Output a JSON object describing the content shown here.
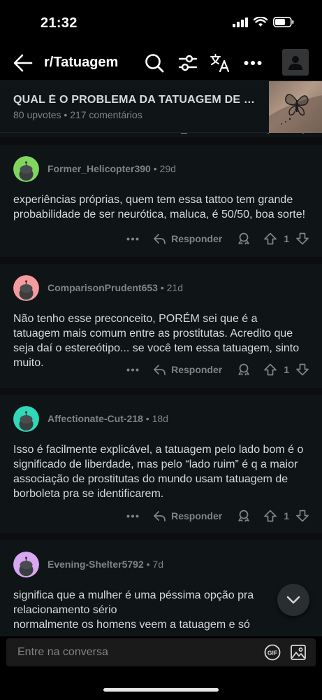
{
  "status_bar": {
    "time": "21:32"
  },
  "header": {
    "title": "r/Tatuagem"
  },
  "post": {
    "title": "QUAL É O PROBLEMA DA TATUAGEM DE BORBOLETA",
    "upvotes": "80 upvotes",
    "comments": "217 comentários"
  },
  "comments": [
    {
      "username": "Former_Helicopter390",
      "age": "29d",
      "avatar_color": "#7fd65c",
      "body": "experiências próprias, quem tem essa tattoo tem grande probabilidade de ser neurótica, maluca, é 50/50, boa sorte!",
      "reply_label": "Responder",
      "score": "1"
    },
    {
      "username": "ComparisonPrudent653",
      "age": "21d",
      "avatar_color": "#f59a9d",
      "body": "Não tenho esse preconceito, PORÉM sei que é a tatuagem mais comum entre as prostitutas. Acredito que seja daí o estereótipo... se você tem essa tatuagem, sinto muito.",
      "reply_label": "Responder",
      "score": "1"
    },
    {
      "username": "Affectionate-Cut-218",
      "age": "18d",
      "avatar_color": "#2fd8b6",
      "body": "Isso é facilmente explicável, a tatuagem pelo lado bom é o significado de liberdade, mas pelo “lado ruim” é q a maior associação de prostitutas do mundo usam tatuagem de borboleta pra se identificarem.",
      "reply_label": "Responder",
      "score": "1"
    },
    {
      "username": "Evening-Shelter5792",
      "age": "7d",
      "avatar_color": "#d9a6f2",
      "body": "significa que a mulher é uma péssima opção pra relacionamento sério\nnormalmente os homens veem a tatuagem e só",
      "reply_label": "Responder",
      "score": "1"
    }
  ],
  "composer": {
    "placeholder": "Entre na conversa",
    "gif_label": "GIF"
  },
  "colors": {
    "background": "#0b0d0e",
    "card": "#0f1416",
    "text": "#d7dadc",
    "muted": "#818384"
  }
}
